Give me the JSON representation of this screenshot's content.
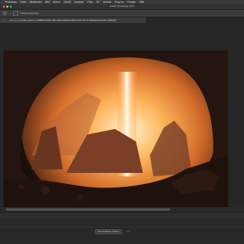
{
  "menubar": {
    "apple": "",
    "items": [
      "Photoshop",
      "Datei",
      "Bearbeiten",
      "Bild",
      "Ebene",
      "Schrift",
      "Auswahl",
      "Filter",
      "3D",
      "Ansicht",
      "Plug-ins",
      "Fenster",
      "Hilfe"
    ]
  },
  "window": {
    "title": "Adobe Photoshop 2023"
  },
  "options_bar": {
    "label": "Transformationsang"
  },
  "document": {
    "tab_label": "×",
    "tab_title": "…_hole_on_a_foreign_planet_f_4d886df0-a565-481e-aa2c-638c19cac0f0.psd bei 66,7% (Background-bild2, RGB/8#) *"
  },
  "panel": {
    "button_label": "Videozeitleiste erstellen",
    "menu_label": "•••"
  },
  "colors": {
    "close": "#ff5f57",
    "minimize": "#febc2e",
    "maximize": "#28c840",
    "ui_dark": "#262626",
    "accent": "#ff9a3a"
  }
}
